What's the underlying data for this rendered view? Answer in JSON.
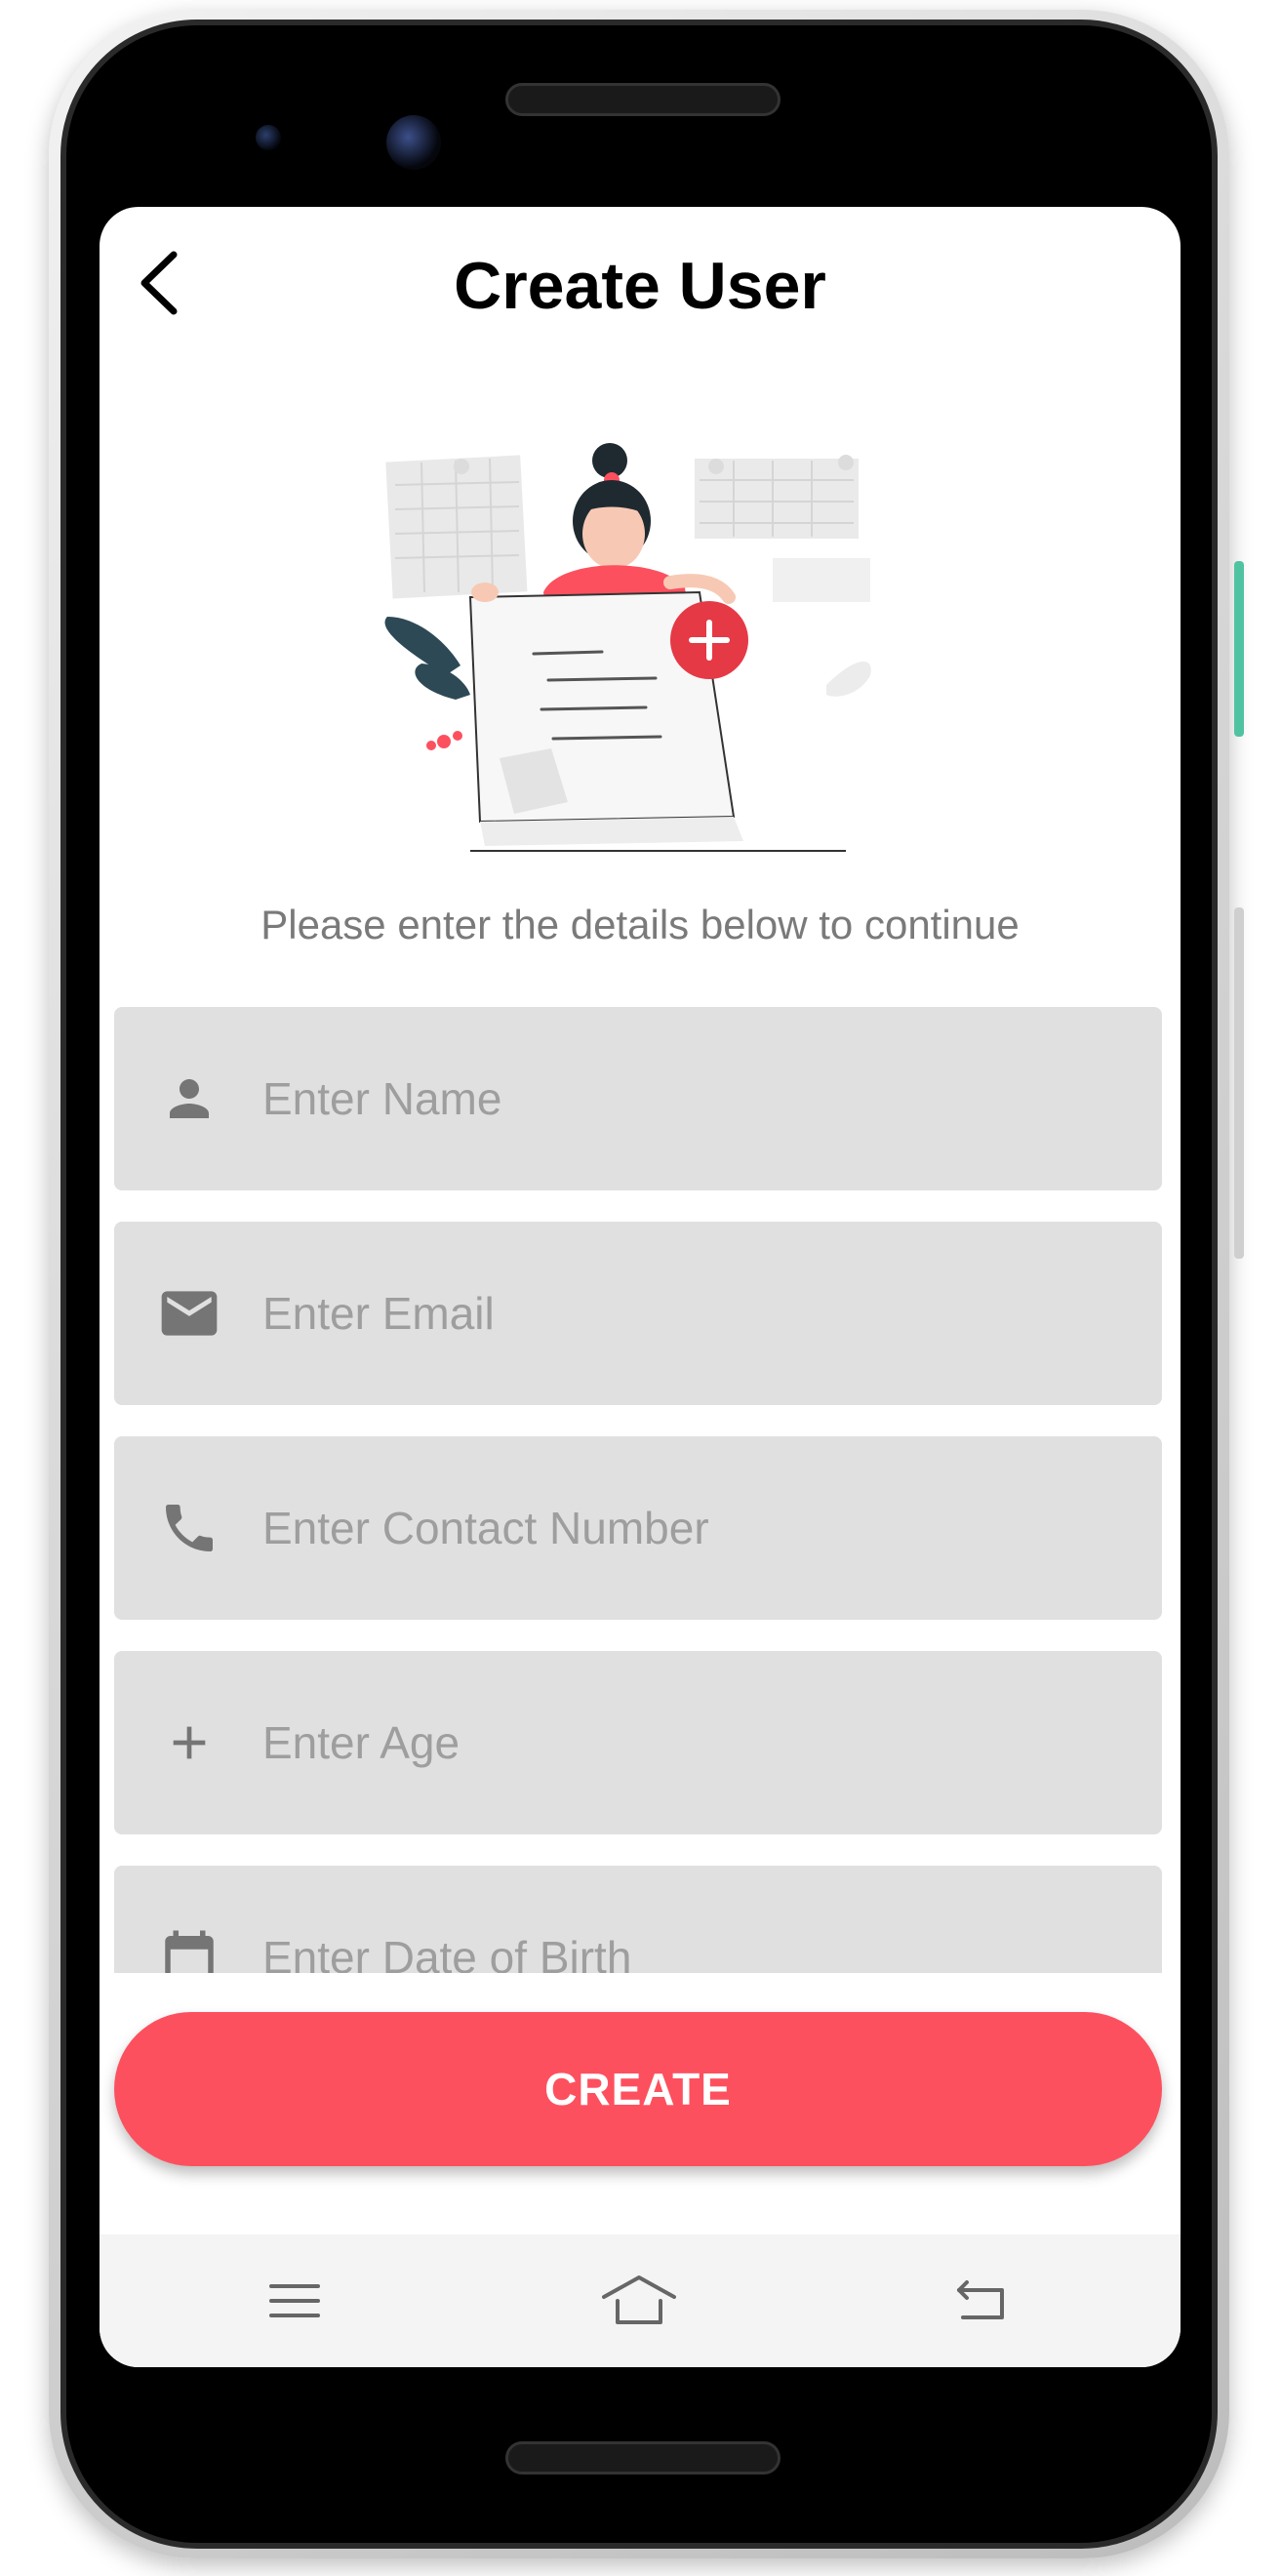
{
  "app": {
    "title": "Create User"
  },
  "header": {
    "back_icon": "chevron-left-icon"
  },
  "main": {
    "subtitle": "Please enter the details below to continue",
    "fields": [
      {
        "icon": "person-icon",
        "placeholder": "Enter Name"
      },
      {
        "icon": "mail-icon",
        "placeholder": "Enter Email"
      },
      {
        "icon": "phone-icon",
        "placeholder": "Enter Contact Number"
      },
      {
        "icon": "plus-icon",
        "placeholder": "Enter Age"
      },
      {
        "icon": "calendar-icon",
        "placeholder": "Enter Date of Birth"
      }
    ],
    "create_label": "CREATE"
  },
  "navbar": {
    "items": [
      "menu-icon",
      "home-icon",
      "back-icon"
    ]
  },
  "colors": {
    "accent": "#fd505f",
    "field_bg": "#e0e0e0",
    "placeholder": "#9e9e9e",
    "icon": "#757575"
  }
}
